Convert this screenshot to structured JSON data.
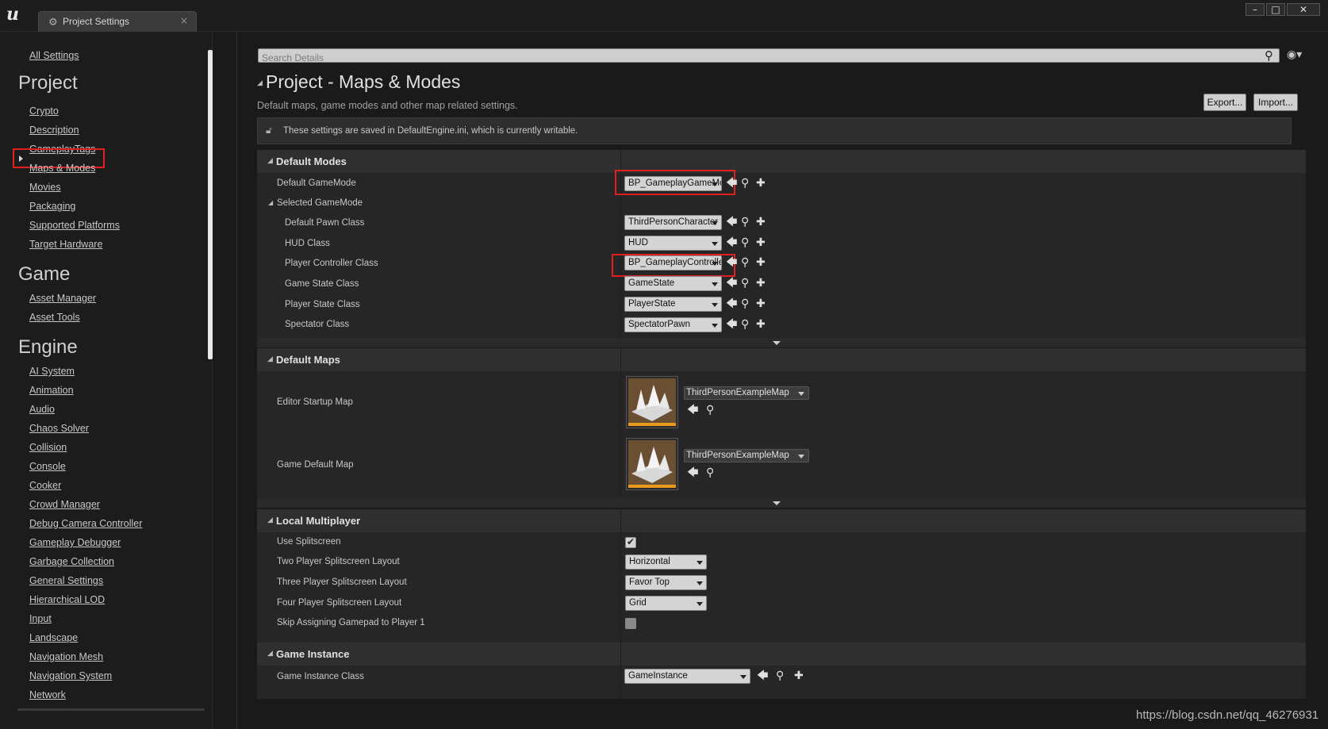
{
  "window": {
    "tab_title": "Project Settings",
    "tab_close": "×",
    "minimize": "–",
    "maximize": "□",
    "close": "✕"
  },
  "sidebar": {
    "all_settings": "All Settings",
    "sections": {
      "project": {
        "title": "Project",
        "items": [
          "Crypto",
          "Description",
          "GameplayTags",
          "Maps & Modes",
          "Movies",
          "Packaging",
          "Supported Platforms",
          "Target Hardware"
        ]
      },
      "game": {
        "title": "Game",
        "items": [
          "Asset Manager",
          "Asset Tools"
        ]
      },
      "engine": {
        "title": "Engine",
        "items": [
          "AI System",
          "Animation",
          "Audio",
          "Chaos Solver",
          "Collision",
          "Console",
          "Cooker",
          "Crowd Manager",
          "Debug Camera Controller",
          "Gameplay Debugger",
          "Garbage Collection",
          "General Settings",
          "Hierarchical LOD",
          "Input",
          "Landscape",
          "Navigation Mesh",
          "Navigation System",
          "Network"
        ]
      }
    },
    "selected": "Maps & Modes"
  },
  "search": {
    "placeholder": "Search Details"
  },
  "header": {
    "title": "Project - Maps & Modes",
    "subtitle": "Default maps, game modes and other map related settings.",
    "export_label": "Export...",
    "import_label": "Import...",
    "notice": "These settings are saved in DefaultEngine.ini, which is currently writable."
  },
  "default_modes": {
    "title": "Default Modes",
    "default_gamemode": {
      "label": "Default GameMode",
      "value": "BP_GameplayGameMode"
    },
    "selected_gamemode": "Selected GameMode",
    "rows": [
      {
        "label": "Default Pawn Class",
        "value": "ThirdPersonCharacter"
      },
      {
        "label": "HUD Class",
        "value": "HUD"
      },
      {
        "label": "Player Controller Class",
        "value": "BP_GameplayController"
      },
      {
        "label": "Game State Class",
        "value": "GameState"
      },
      {
        "label": "Player State Class",
        "value": "PlayerState"
      },
      {
        "label": "Spectator Class",
        "value": "SpectatorPawn"
      }
    ]
  },
  "default_maps": {
    "title": "Default Maps",
    "editor_startup_map": {
      "label": "Editor Startup Map",
      "value": "ThirdPersonExampleMap"
    },
    "game_default_map": {
      "label": "Game Default Map",
      "value": "ThirdPersonExampleMap"
    }
  },
  "local_multiplayer": {
    "title": "Local Multiplayer",
    "use_splitscreen": {
      "label": "Use Splitscreen",
      "checked": true
    },
    "two_player": {
      "label": "Two Player Splitscreen Layout",
      "value": "Horizontal"
    },
    "three_player": {
      "label": "Three Player Splitscreen Layout",
      "value": "Favor Top"
    },
    "four_player": {
      "label": "Four Player Splitscreen Layout",
      "value": "Grid"
    },
    "skip_gamepad": {
      "label": "Skip Assigning Gamepad to Player 1",
      "checked": false
    }
  },
  "game_instance": {
    "title": "Game Instance",
    "class": {
      "label": "Game Instance Class",
      "value": "GameInstance"
    }
  },
  "watermark": "https://blog.csdn.net/qq_46276931",
  "colors": {
    "highlight": "#e02020",
    "accent": "#e89a1e"
  }
}
